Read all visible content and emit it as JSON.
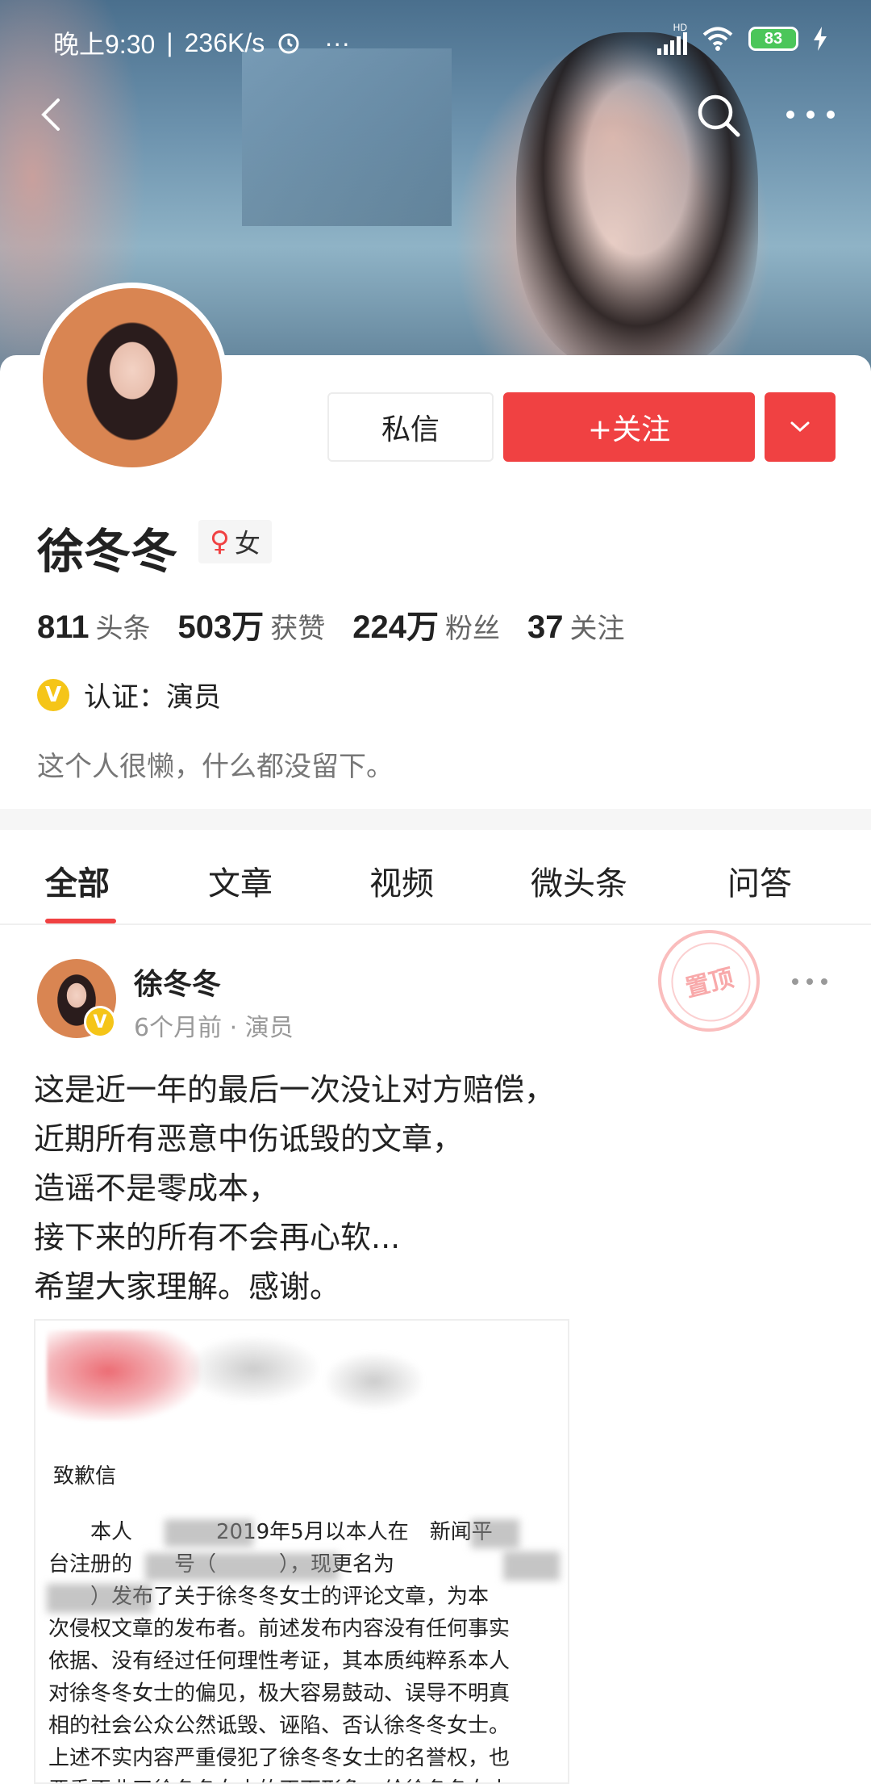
{
  "status_bar": {
    "time": "晚上9:30",
    "speed": "236K/s",
    "dots": "···",
    "hd": "HD",
    "battery": "83"
  },
  "profile": {
    "message_label": "私信",
    "follow_label": "+关注",
    "name": "徐冬冬",
    "gender_symbol": "♀",
    "gender": "女",
    "stats": [
      {
        "num": "811",
        "label": "头条"
      },
      {
        "num": "503万",
        "label": "获赞"
      },
      {
        "num": "224万",
        "label": "粉丝"
      },
      {
        "num": "37",
        "label": "关注"
      }
    ],
    "verify_label": "认证：演员",
    "bio": "这个人很懒，什么都没留下。"
  },
  "tabs": [
    "全部",
    "文章",
    "视频",
    "微头条",
    "问答"
  ],
  "post": {
    "author": "徐冬冬",
    "meta": "6个月前 · 演员",
    "pinned_stamp": "置顶",
    "lines": [
      "这是近一年的最后一次没让对方赔偿，",
      "近期所有恶意中伤诋毁的文章，",
      "造谣不是零成本，",
      "接下来的所有不会再心软...",
      "希望大家理解。感谢。"
    ],
    "letter": {
      "title": "致歉信",
      "lines": [
        "　　本人　　　　2019年5月以本人在　新闻平",
        "台注册的　　号（　　　），现更名为",
        "　　）发布了关于徐冬冬女士的评论文章，为本",
        "次侵权文章的发布者。前述发布内容没有任何事实",
        "依据、没有经过任何理性考证，其本质纯粹系本人",
        "对徐冬冬女士的偏见，极大容易鼓动、误导不明真",
        "相的社会公众公然诋毁、诬陷、否认徐冬冬女士。",
        "上述不实内容严重侵犯了徐冬冬女士的名誉权，也",
        "严重歪曲了徐冬冬女士的正面形象，给徐冬冬女士"
      ]
    }
  },
  "colors": {
    "accent": "#f04142",
    "verify": "#f5c518",
    "battery": "#4bc65a"
  }
}
